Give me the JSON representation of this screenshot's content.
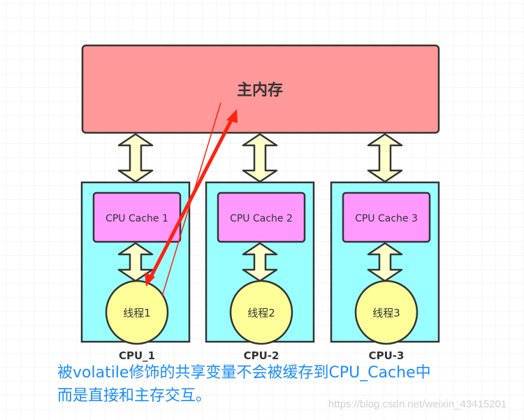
{
  "main_memory": {
    "label": "主内存",
    "color": "#ff9999"
  },
  "cpus": [
    {
      "label": "CPU_1",
      "cache": "CPU  Cache  1",
      "thread": "线程1"
    },
    {
      "label": "CPU-2",
      "cache": "CPU  Cache 2",
      "thread": "线程2"
    },
    {
      "label": "CPU-3",
      "cache": "CPU  Cache 3",
      "thread": "线程3"
    }
  ],
  "colors": {
    "cpu": "#99ffff",
    "cache": "#ff99ff",
    "thread": "#ffff99",
    "arrow": "#ffffcc",
    "red_arrow": "#ff2211",
    "caption": "#1a8cff"
  },
  "caption": {
    "line1": "被volatile修饰的共享变量不会被缓存到CPU_Cache中",
    "line2": "而是直接和主存交互。"
  },
  "watermark": "https://blog.csdn.net/weixin_43415201"
}
